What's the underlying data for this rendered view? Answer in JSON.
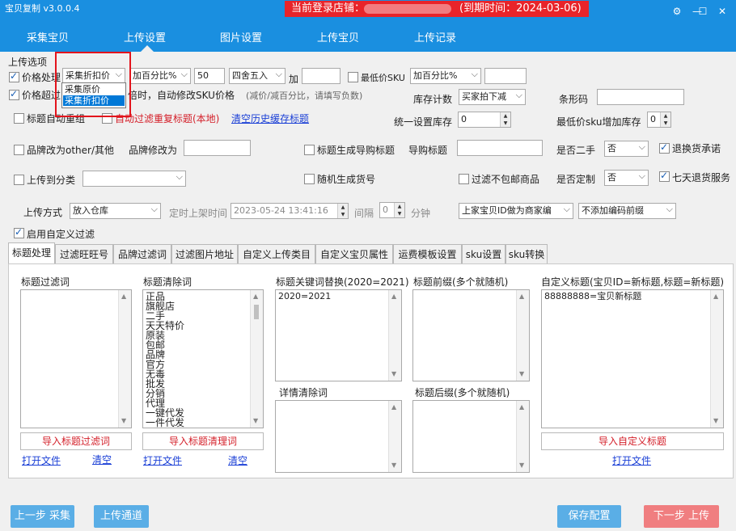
{
  "titlebar": {
    "app_title": "宝贝复制 v3.0.0.4",
    "store_label": "当前登录店铺：",
    "store_expire": "(到期时间：2024-03-06)",
    "controls": [
      "⚙",
      "—",
      "☐",
      "✕"
    ]
  },
  "nav": [
    "采集宝贝",
    "上传设置",
    "图片设置",
    "上传宝贝",
    "上传记录"
  ],
  "upload_options": {
    "group_label": "上传选项",
    "price_handle_label": "价格处理",
    "price_handle_value": "采集折扣价",
    "dropdown_options": [
      "采集原价",
      "采集折扣价"
    ],
    "add_percent_value": "加百分比%",
    "percent_value": "50",
    "rounding_value": "四舍五入",
    "add_label": "加",
    "add_value": "",
    "min_price_sku_label": "最低价SKU",
    "min_price_mode_value": "加百分比%",
    "min_price_value": "",
    "price_over_prefix": "价格超过",
    "price_over_suffix": "倍时，自动修改SKU价格",
    "price_over_hint": "(减价/减百分比，请填写负数)",
    "stock_count_label": "库存计数",
    "stock_count_value": "买家拍下减",
    "barcode_label": "条形码",
    "barcode_value": "",
    "title_auto_combine": "标题自动重组",
    "auto_filter_dup": "自动过滤重复标题(本地)",
    "clear_history": "清空历史缓存标题",
    "unified_stock_label": "统一设置库存",
    "unified_stock_value": "0",
    "min_sku_stock_label": "最低价sku增加库存",
    "min_sku_stock_value": "0",
    "brand_other": "品牌改为other/其他",
    "brand_change_label": "品牌修改为",
    "brand_change_value": "",
    "title_guide": "标题生成导购标题",
    "guide_title_label": "导购标题",
    "guide_title_value": "",
    "second_hand_label": "是否二手",
    "second_hand_value": "否",
    "return_promise": "退换货承诺",
    "upload_category": "上传到分类",
    "category_value": "",
    "random_item_no": "随机生成货号",
    "filter_no_free_ship": "过滤不包邮商品",
    "custom_made_label": "是否定制",
    "custom_made_value": "否",
    "seven_day_return": "七天退货服务",
    "upload_method_label": "上传方式",
    "upload_method_value": "放入仓库",
    "timed_listing_label": "定时上架时间",
    "timed_listing_value": "2023-05-24 13:41:16",
    "interval_label": "间隔",
    "interval_value": "0",
    "minute_label": "分钟",
    "merchant_code_value": "上家宝贝ID做为商家编",
    "prefix_code_value": "不添加编码前缀",
    "enable_custom_filter": "启用自定义过滤"
  },
  "tabs": [
    "标题处理",
    "过滤旺旺号",
    "品牌过滤词",
    "过滤图片地址",
    "自定义上传类目",
    "自定义宝贝属性",
    "运费模板设置",
    "sku设置",
    "sku转换"
  ],
  "panel": {
    "title_filter_label": "标题过滤词",
    "title_clean_label": "标题清除词",
    "title_clean_words": [
      "正品",
      "旗舰店",
      "二手",
      "天天特价",
      "原装",
      "包邮",
      "品牌",
      "官方",
      "无毒",
      "批发",
      "分销",
      "代理",
      "一键代发",
      "一件代发"
    ],
    "keyword_replace_label": "标题关键词替换(2020=2021)",
    "keyword_replace_value": "2020=2021",
    "title_prefix_label": "标题前缀(多个就随机)",
    "custom_title_label": "自定义标题(宝贝ID=新标题,标题=新标题)",
    "custom_title_value": "88888888=宝贝新标题",
    "detail_clear_label": "详情清除词",
    "title_suffix_label": "标题后缀(多个就随机)",
    "import_title_filter": "导入标题过滤词",
    "import_title_clean": "导入标题清理词",
    "import_custom_title": "导入自定义标题",
    "open_file": "打开文件",
    "clear": "清空"
  },
  "bottom": {
    "prev_step": "上一步 采集",
    "upload_channel": "上传通道",
    "save_config": "保存配置",
    "next_step": "下一步 上传"
  }
}
